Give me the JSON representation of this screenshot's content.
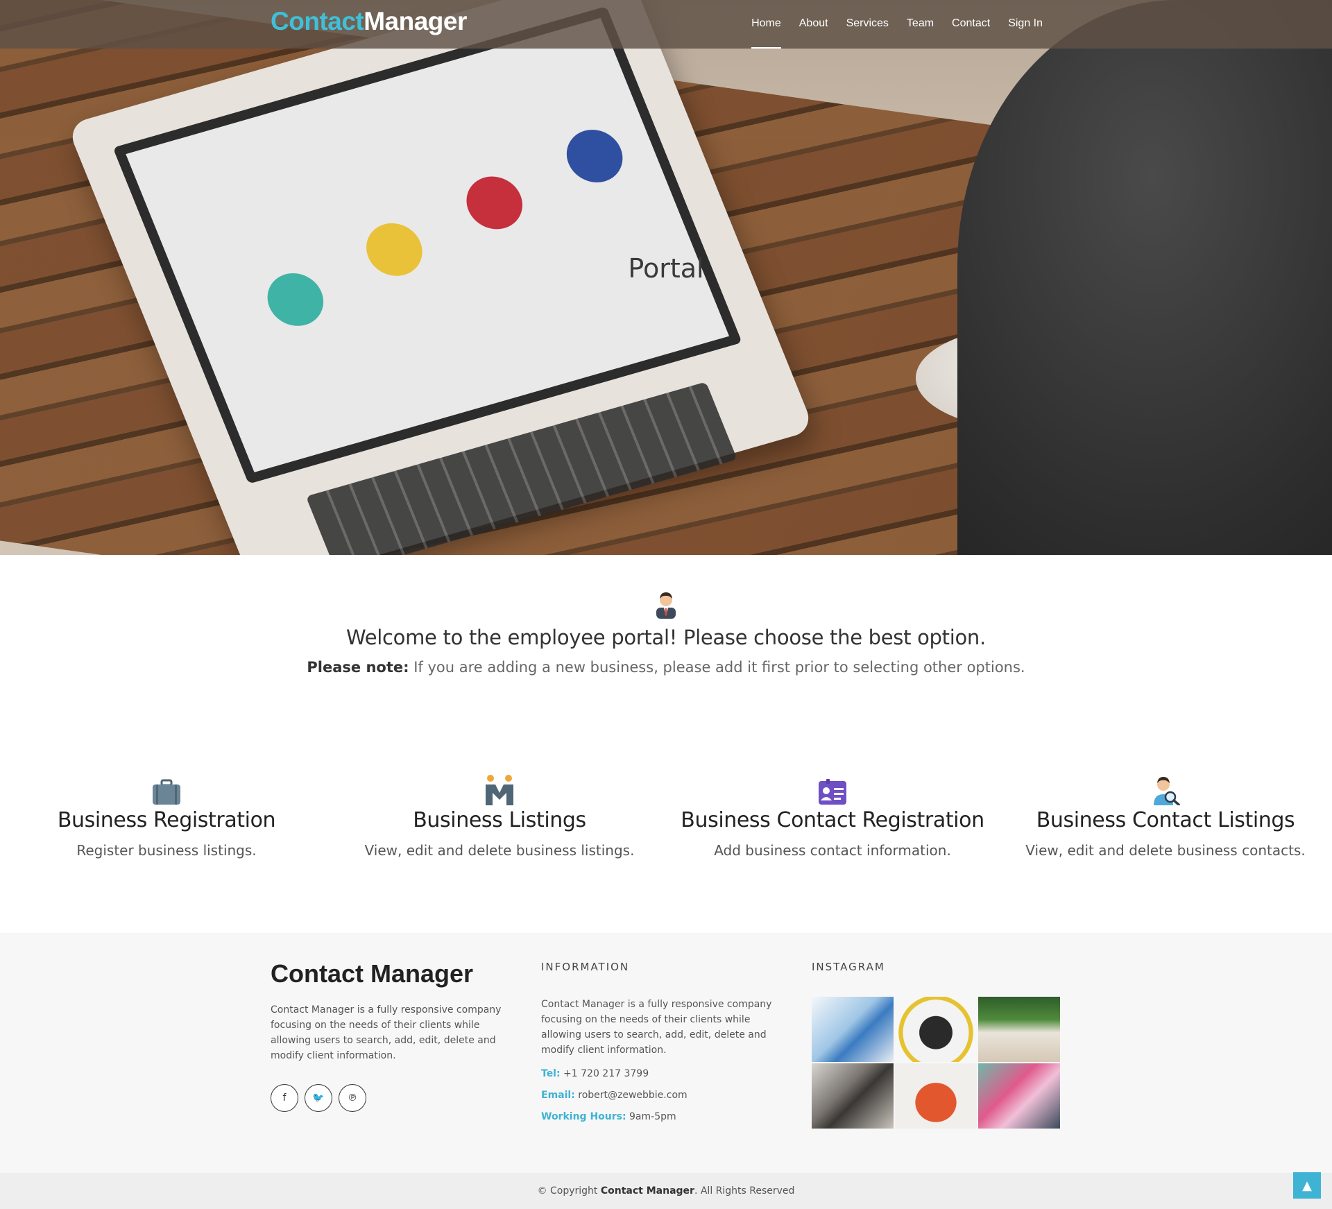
{
  "brand": {
    "part1": "Contact",
    "part2": "Manager"
  },
  "nav": {
    "items": [
      {
        "label": "Home",
        "active": true
      },
      {
        "label": "About",
        "active": false
      },
      {
        "label": "Services",
        "active": false
      },
      {
        "label": "Team",
        "active": false
      },
      {
        "label": "Contact",
        "active": false
      },
      {
        "label": "Sign In",
        "active": false
      }
    ]
  },
  "hero": {
    "title": "Portal"
  },
  "welcome": {
    "heading": "Welcome to the employee portal! Please choose the best option.",
    "note_label": "Please note:",
    "note_text": " If you are adding a new business, please add it first prior to selecting other options."
  },
  "features": [
    {
      "icon": "briefcase-icon",
      "title": "Business Registration",
      "desc": "Register business listings."
    },
    {
      "icon": "handshake-people-icon",
      "title": "Business Listings",
      "desc": "View, edit and delete business listings."
    },
    {
      "icon": "contact-card-icon",
      "title": "Business Contact Registration",
      "desc": "Add business contact information."
    },
    {
      "icon": "person-search-icon",
      "title": "Business Contact Listings",
      "desc": "View, edit and delete business contacts."
    }
  ],
  "footer": {
    "brand": "Contact Manager",
    "about": "Contact Manager is a fully responsive company focusing on the needs of their clients while allowing users to search, add, edit, delete and modify client information.",
    "info_title": "INFORMATION",
    "info_text": "Contact Manager is a fully responsive company focusing on the needs of their clients while allowing users to search, add, edit, delete and modify client information.",
    "tel_label": "Tel:",
    "tel": " +1 720 217 3799",
    "email_label": "Email:",
    "email": " robert@zewebbie.com",
    "hours_label": "Working Hours:",
    "hours": " 9am-5pm",
    "instagram_title": "INSTAGRAM",
    "social": [
      {
        "icon": "facebook-icon",
        "glyph": "f"
      },
      {
        "icon": "twitter-icon",
        "glyph": "🐦"
      },
      {
        "icon": "pinterest-icon",
        "glyph": "℗"
      }
    ],
    "copyright_prefix": "© Copyright ",
    "copyright_brand": "Contact Manager",
    "copyright_suffix": ". All Rights Reserved",
    "back_to_top_glyph": "▲"
  },
  "colors": {
    "accent": "#3fb3d3",
    "brand_cyan": "#3fc0d8",
    "nav_bg": "#5f5046"
  }
}
